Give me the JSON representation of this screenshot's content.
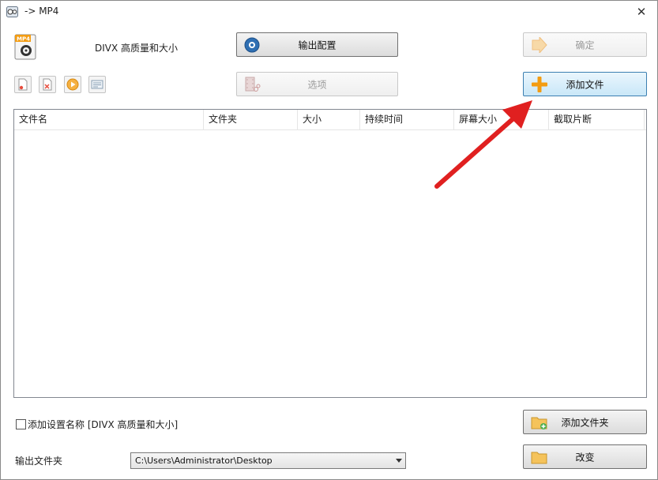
{
  "window": {
    "title": "-> MP4",
    "close_glyph": "✕"
  },
  "header": {
    "logo_text": "MP4",
    "preset_name": "DIVX 高质量和大小"
  },
  "buttons": {
    "output_config": "输出配置",
    "ok": "确定",
    "options": "选项",
    "add_file": "添加文件",
    "add_folder": "添加文件夹",
    "change": "改变"
  },
  "toolbar_icons": [
    "new-file-icon",
    "delete-file-icon",
    "play-icon",
    "info-icon"
  ],
  "file_list": {
    "columns": [
      "文件名",
      "文件夹",
      "大小",
      "持续时间",
      "屏幕大小",
      "截取片断"
    ],
    "rows": []
  },
  "add_preset_name": {
    "checked": false,
    "label": "添加设置名称 [DIVX 高质量和大小]"
  },
  "output_folder": {
    "label": "输出文件夹",
    "path": "C:\\Users\\Administrator\\Desktop"
  },
  "colors": {
    "annotation_arrow": "#e02020",
    "add_icon": "#f39c12"
  }
}
